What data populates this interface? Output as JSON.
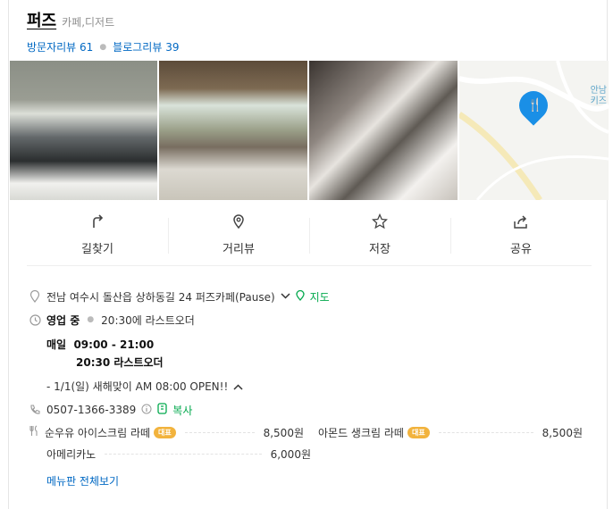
{
  "place": {
    "name": "퍼즈",
    "category": "카페,디저트",
    "visitor_review_label": "방문자리뷰",
    "visitor_review_count": "61",
    "blog_review_label": "블로그리뷰",
    "blog_review_count": "39"
  },
  "map": {
    "label_line1": "안남",
    "label_line2": "키즈"
  },
  "actions": [
    {
      "label": "길찾기",
      "icon": "directions-icon"
    },
    {
      "label": "거리뷰",
      "icon": "street-view-icon"
    },
    {
      "label": "저장",
      "icon": "star-icon"
    },
    {
      "label": "공유",
      "icon": "share-icon"
    }
  ],
  "info": {
    "address": "전남 여수시 돌산읍 상하동길 24 퍼즈카페(Pause)",
    "map_link": "지도",
    "status": "영업 중",
    "last_order": "20:30에 라스트오더",
    "hours_day": "매일",
    "hours_time": "09:00 - 21:00",
    "hours_last": "20:30 라스트오더",
    "notice": "- 1/1(일) 새해맞이 AM 08:00 OPEN!!",
    "phone": "0507-1366-3389",
    "copy": "복사"
  },
  "menu": {
    "items": [
      {
        "name": "순우유 아이스크림 라떼",
        "badge": "대표",
        "price": "8,500원"
      },
      {
        "name": "아몬드 생크림 라떼",
        "badge": "대표",
        "price": "8,500원"
      },
      {
        "name": "아메리카노",
        "badge": "",
        "price": "6,000원"
      }
    ],
    "view_all": "메뉴판 전체보기"
  },
  "colors": {
    "link": "#0068c3",
    "green": "#03a94d",
    "badge": "#f2b33d",
    "pin": "#1a8fe6"
  }
}
